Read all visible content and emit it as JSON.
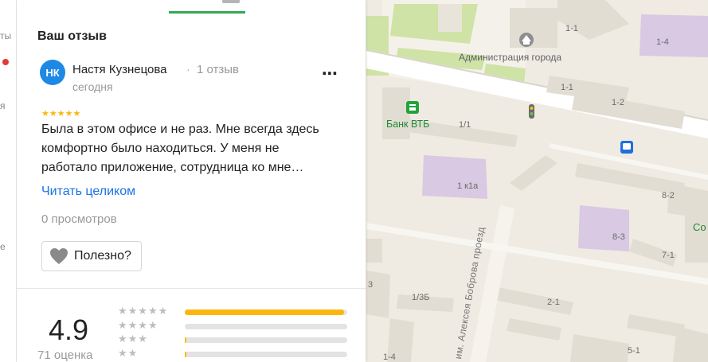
{
  "colors": {
    "accent_green": "#34a853",
    "star_yellow": "#fbb70d",
    "link_blue": "#1a73e8",
    "avatar_blue": "#1e88e5"
  },
  "left_strip": {
    "fragments": [
      "ты",
      "я",
      "е"
    ]
  },
  "review": {
    "section_title": "Ваш отзыв",
    "avatar_initials": "НК",
    "author": "Настя Кузнецова",
    "separator": "·",
    "author_reviews": "1 отзыв",
    "date": "сегодня",
    "more_icon": "⋯",
    "stars": "★★★★★",
    "rating": 5,
    "text": "Была в этом офисе и не раз. Мне всегда здесь комфортно было находиться. У меня не работало приложение, сотрудница ко мне…",
    "read_more": "Читать целиком",
    "views": "0 просмотров",
    "helpful_label": "Полезно?"
  },
  "summary": {
    "rating": "4.9",
    "count": "71 оценка",
    "distribution": [
      {
        "stars": "★★★★★",
        "fraction": 0.98
      },
      {
        "stars": "★★★★",
        "fraction": 0.0
      },
      {
        "stars": "★★★",
        "fraction": 0.01
      },
      {
        "stars": "★★",
        "fraction": 0.01
      }
    ]
  },
  "map": {
    "poi_admin": "Администрация города",
    "poi_bank": "Банк ВТБ",
    "street": "им. Алексея Боброва проезд",
    "edge_label": "Со",
    "house_numbers": [
      "1-1",
      "1-4",
      "1-1",
      "1-2",
      "1/1",
      "1 к1а",
      "8-2",
      "8-3",
      "7-1",
      "1/3Б",
      "3",
      "2-1",
      "5-1",
      "1-4"
    ]
  }
}
